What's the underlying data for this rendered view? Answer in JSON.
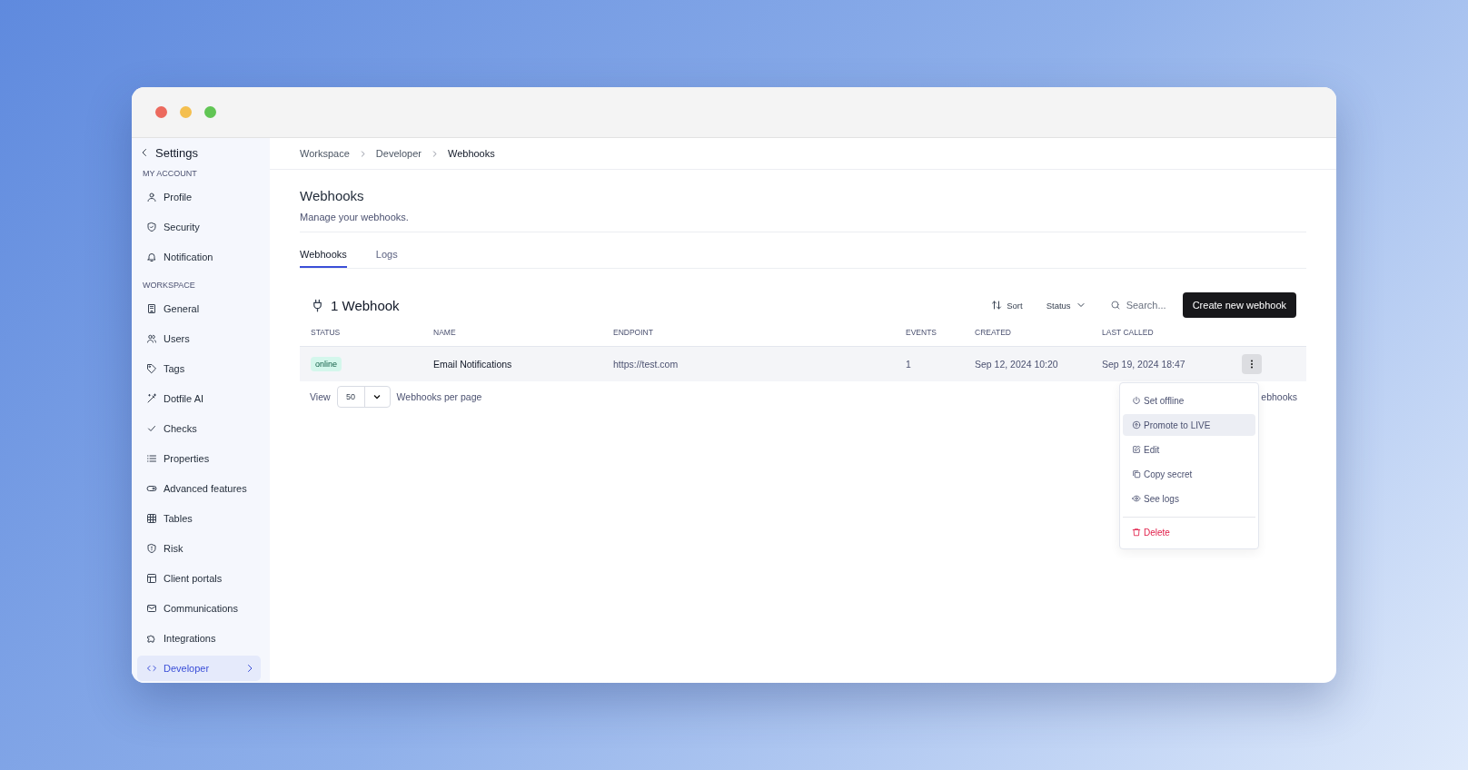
{
  "sidebar": {
    "back_label": "Settings",
    "sections": [
      {
        "title": "MY ACCOUNT",
        "items": [
          {
            "label": "Profile",
            "selected": false
          },
          {
            "label": "Security",
            "selected": false
          },
          {
            "label": "Notification",
            "selected": false
          }
        ]
      },
      {
        "title": "WORKSPACE",
        "items": [
          {
            "label": "General",
            "selected": false
          },
          {
            "label": "Users",
            "selected": false
          },
          {
            "label": "Tags",
            "selected": false
          },
          {
            "label": "Dotfile AI",
            "selected": false
          },
          {
            "label": "Checks",
            "selected": false
          },
          {
            "label": "Properties",
            "selected": false
          },
          {
            "label": "Advanced features",
            "selected": false
          },
          {
            "label": "Tables",
            "selected": false
          },
          {
            "label": "Risk",
            "selected": false
          },
          {
            "label": "Client portals",
            "selected": false
          },
          {
            "label": "Communications",
            "selected": false
          },
          {
            "label": "Integrations",
            "selected": false
          },
          {
            "label": "Developer",
            "selected": true
          }
        ]
      }
    ]
  },
  "breadcrumb": [
    "Workspace",
    "Developer",
    "Webhooks"
  ],
  "page": {
    "title": "Webhooks",
    "subtitle": "Manage your webhooks."
  },
  "tabs": [
    {
      "label": "Webhooks",
      "selected": true
    },
    {
      "label": "Logs",
      "selected": false
    }
  ],
  "toolbar": {
    "count": "1 Webhook",
    "sort": "Sort",
    "status": "Status",
    "search_placeholder": "Search...",
    "create": "Create new webhook"
  },
  "table": {
    "columns": [
      "STATUS",
      "NAME",
      "ENDPOINT",
      "EVENTS",
      "CREATED",
      "LAST CALLED"
    ],
    "rows": [
      {
        "status": "online",
        "name": "Email Notifications",
        "endpoint": "https://test.com",
        "events": "1",
        "created": "Sep 12, 2024 10:20",
        "last_called": "Sep 19, 2024 18:47"
      }
    ]
  },
  "pagination": {
    "view": "View",
    "per_page_value": "50",
    "per_page": "Webhooks per page",
    "total": "ebhooks"
  },
  "menu": [
    {
      "label": "Set offline",
      "kind": "action",
      "highlighted": false
    },
    {
      "label": "Promote to LIVE",
      "kind": "action",
      "highlighted": true
    },
    {
      "label": "Edit",
      "kind": "action",
      "highlighted": false
    },
    {
      "label": "Copy secret",
      "kind": "action",
      "highlighted": false
    },
    {
      "label": "See logs",
      "kind": "action",
      "highlighted": false
    },
    {
      "label": "Delete",
      "kind": "danger",
      "highlighted": false
    }
  ]
}
